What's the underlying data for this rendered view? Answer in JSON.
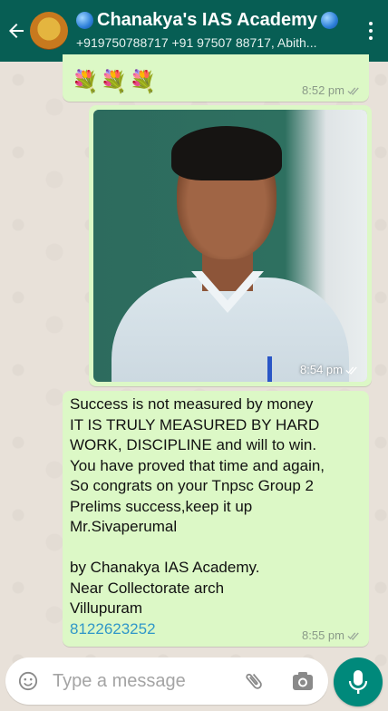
{
  "header": {
    "title": "Chanakya's IAS Academy",
    "subtitle": "+919750788717 +91 97507 88717, Abith..."
  },
  "messages": [
    {
      "type": "emoji",
      "content": "💐💐💐",
      "time": "8:52 pm",
      "status": "read"
    },
    {
      "type": "image",
      "time": "8:54 pm",
      "status": "read"
    },
    {
      "type": "text",
      "text": "Success is not measured by money\nIT IS TRULY MEASURED BY HARD\nWORK, DISCIPLINE and will to win.\nYou have proved that time and again,\nSo congrats on your Tnpsc Group 2\nPrelims success,keep it up\nMr.Sivaperumal\n\nby Chanakya IAS Academy.\nNear Collectorate arch\nVillupuram\n",
      "phone": "8122623252",
      "time": "8:55 pm",
      "status": "read"
    }
  ],
  "composer": {
    "placeholder": "Type a message"
  },
  "icons": {
    "back": "arrow-left-icon",
    "menu": "more-vert-icon",
    "emoji": "emoji-icon",
    "attach": "paperclip-icon",
    "camera": "camera-icon",
    "mic": "mic-icon"
  },
  "colors": {
    "header": "#075e54",
    "bubble_out": "#dcf8c6",
    "fab": "#00897b",
    "link": "#3097c8"
  }
}
